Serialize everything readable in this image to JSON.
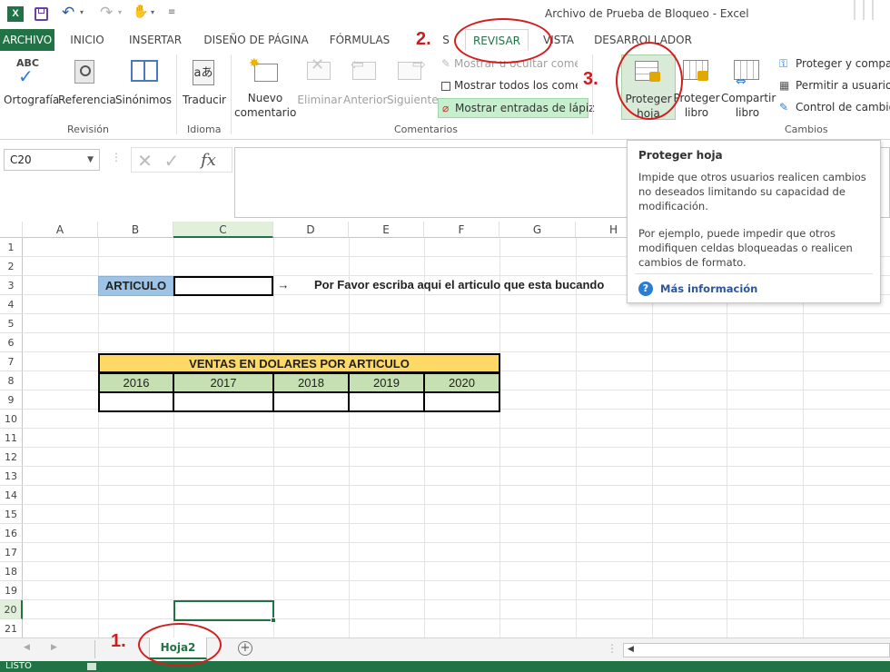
{
  "window": {
    "title": "Archivo de Prueba de Bloqueo - Excel"
  },
  "tabs": [
    {
      "label": "ARCHIVO"
    },
    {
      "label": "INICIO"
    },
    {
      "label": "INSERTAR"
    },
    {
      "label": "DISEÑO DE PÁGINA"
    },
    {
      "label": "FÓRMULAS"
    },
    {
      "label": "S"
    },
    {
      "label": "REVISAR"
    },
    {
      "label": "VISTA"
    },
    {
      "label": "DESARROLLADOR"
    }
  ],
  "ribbon": {
    "revision": {
      "ortografia": "Ortografía",
      "referencia": "Referencia",
      "sinonimos": "Sinónimos",
      "label": "Revisión",
      "abc": "ABC"
    },
    "idioma": {
      "traducir": "Traducir",
      "label": "Idioma"
    },
    "comentarios": {
      "nuevo_line1": "Nuevo",
      "nuevo_line2": "comentario",
      "eliminar": "Eliminar",
      "anterior": "Anterior",
      "siguiente": "Siguiente",
      "mostrar_ocultar": "Mostrar u ocultar come",
      "mostrar_todos": "Mostrar todos los come",
      "mostrar_lapiz": "Mostrar entradas de lápiz",
      "label": "Comentarios"
    },
    "cambios": {
      "proteger_hoja_1": "Proteger",
      "proteger_hoja_2": "hoja",
      "proteger_libro_1": "Proteger",
      "proteger_libro_2": "libro",
      "compartir_libro_1": "Compartir",
      "compartir_libro_2": "libro",
      "proteger_compartir": "Proteger y compar",
      "permitir_usuarios": "Permitir a usuarios",
      "control_cambios": "Control de cambio",
      "label": "Cambios"
    }
  },
  "formula_bar": {
    "name_box": "C20",
    "fx": "fx",
    "formula": ""
  },
  "tooltip": {
    "title": "Proteger hoja",
    "p1": "Impide que otros usuarios realicen cambios no deseados limitando su capacidad de modificación.",
    "p2": "Por ejemplo, puede impedir que otros modifiquen celdas bloqueadas o realicen cambios de formato.",
    "link": "Más información"
  },
  "columns": [
    "A",
    "B",
    "C",
    "D",
    "E",
    "F",
    "G",
    "H"
  ],
  "rows": [
    "1",
    "2",
    "3",
    "4",
    "5",
    "6",
    "7",
    "8",
    "9",
    "10",
    "11",
    "12",
    "13",
    "14",
    "15",
    "16",
    "17",
    "18",
    "19",
    "20",
    "21"
  ],
  "sheet": {
    "articulo_label": "ARTICULO",
    "arrow": "→",
    "instruction": "Por Favor escriba aqui el articulo que esta bucando",
    "table_title": "VENTAS EN DOLARES POR ARTICULO",
    "years": [
      "2016",
      "2017",
      "2018",
      "2019",
      "2020"
    ]
  },
  "sheet_tabs": [
    {
      "label": "Hoja2"
    }
  ],
  "status": {
    "mode": "LISTO"
  },
  "annotations": {
    "step1": "1.",
    "step2": "2.",
    "step3": "3."
  },
  "colors": {
    "excel_green": "#217346",
    "annotation_red": "#d41d1d",
    "header_blue": "#9dc3e6",
    "title_yellow": "#ffd966",
    "year_green": "#c6e0b4"
  }
}
